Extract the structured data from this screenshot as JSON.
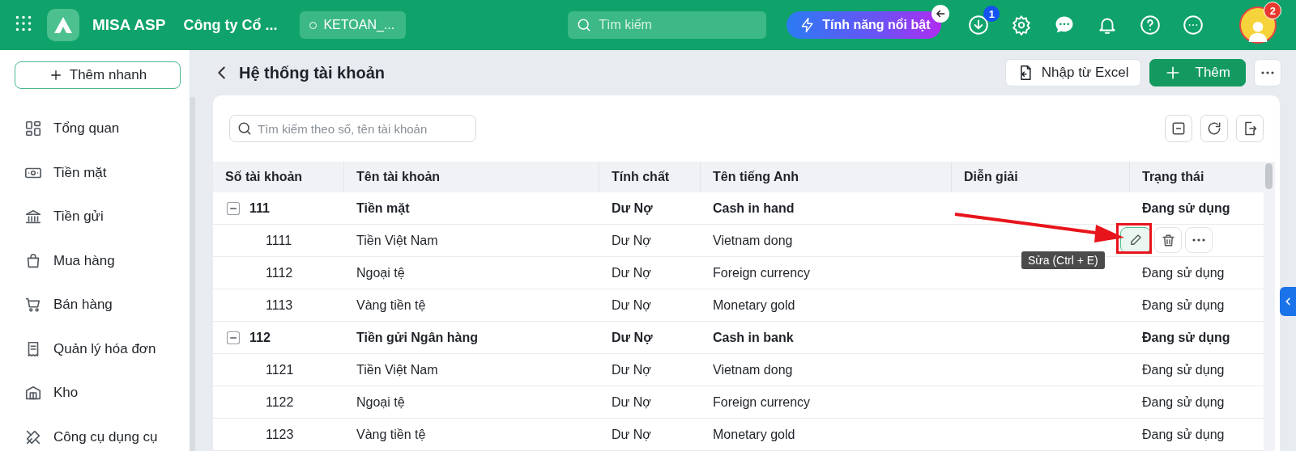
{
  "topbar": {
    "app_name": "MISA ASP",
    "company": "Công ty Cổ ...",
    "database": "KETOAN_...",
    "search": {
      "placeholder": "Tìm kiếm"
    },
    "features_button": "Tính năng nổi bật",
    "download_badge": "1",
    "avatar_badge": "2"
  },
  "sidebar": {
    "quick_add": "Thêm nhanh",
    "items": [
      {
        "label": "Tổng quan"
      },
      {
        "label": "Tiền mặt"
      },
      {
        "label": "Tiền gửi"
      },
      {
        "label": "Mua hàng"
      },
      {
        "label": "Bán hàng"
      },
      {
        "label": "Quản lý hóa đơn"
      },
      {
        "label": "Kho"
      },
      {
        "label": "Công cụ dụng cụ"
      }
    ]
  },
  "page": {
    "title": "Hệ thống tài khoản",
    "import_button": "Nhập từ Excel",
    "add_button": "Thêm"
  },
  "table": {
    "search": {
      "placeholder": "Tìm kiếm theo số, tên tài khoản"
    },
    "columns": [
      "Số tài khoản",
      "Tên tài khoản",
      "Tính chất",
      "Tên tiếng Anh",
      "Diễn giải",
      "Trạng thái"
    ],
    "rows": [
      {
        "number": "111",
        "name": "Tiền mặt",
        "nature": "Dư Nợ",
        "english_name": "Cash in hand",
        "status": "Đang sử dụng",
        "expanded": true,
        "children": [
          {
            "number": "1111",
            "name": "Tiền Việt Nam",
            "nature": "Dư Nợ",
            "english_name": "Vietnam dong",
            "hovered": true,
            "tooltip": "Sửa (Ctrl + E)"
          },
          {
            "number": "1112",
            "name": "Ngoại tệ",
            "nature": "Dư Nợ",
            "english_name": "Foreign currency",
            "status": "Đang sử dụng",
            "hovered": false
          },
          {
            "number": "1113",
            "name": "Vàng tiền tệ",
            "nature": "Dư Nợ",
            "english_name": "Monetary gold",
            "status": "Đang sử dụng",
            "hovered": false
          }
        ]
      },
      {
        "number": "112",
        "name": "Tiền gửi Ngân hàng",
        "nature": "Dư Nợ",
        "english_name": "Cash in bank",
        "status": "Đang sử dụng",
        "expanded": true,
        "children": [
          {
            "number": "1121",
            "name": "Tiền Việt Nam",
            "nature": "Dư Nợ",
            "english_name": "Vietnam dong",
            "status": "Đang sử dụng",
            "hovered": false
          },
          {
            "number": "1122",
            "name": "Ngoại tệ",
            "nature": "Dư Nợ",
            "english_name": "Foreign currency",
            "status": "Đang sử dụng",
            "hovered": false
          },
          {
            "number": "1123",
            "name": "Vàng tiền tệ",
            "nature": "Dư Nợ",
            "english_name": "Monetary gold",
            "status": "Đang sử dụng",
            "hovered": false
          }
        ]
      }
    ]
  }
}
